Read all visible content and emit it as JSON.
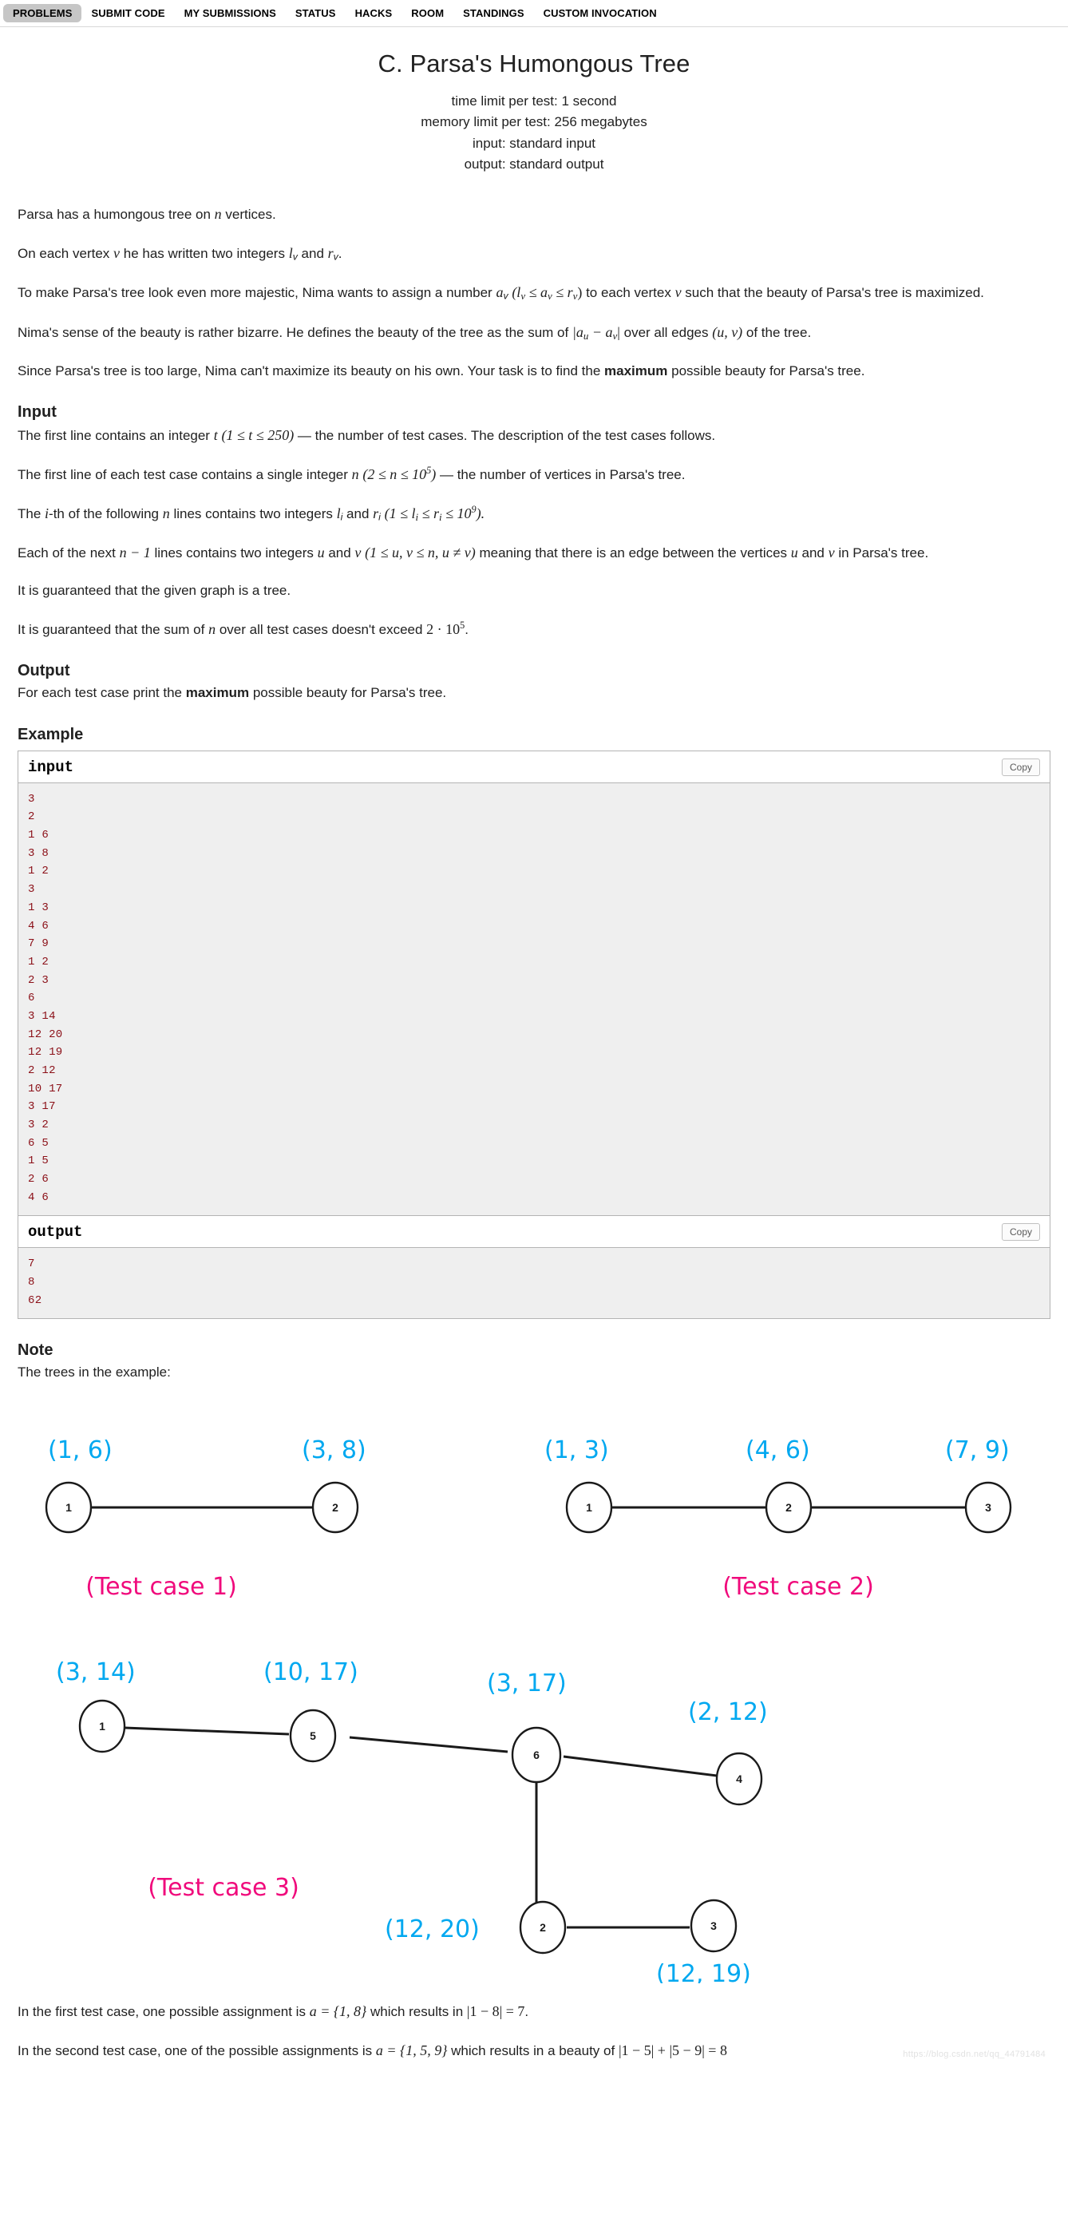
{
  "nav": {
    "items": [
      {
        "label": "PROBLEMS",
        "active": true
      },
      {
        "label": "SUBMIT CODE",
        "active": false
      },
      {
        "label": "MY SUBMISSIONS",
        "active": false
      },
      {
        "label": "STATUS",
        "active": false
      },
      {
        "label": "HACKS",
        "active": false
      },
      {
        "label": "ROOM",
        "active": false
      },
      {
        "label": "STANDINGS",
        "active": false
      },
      {
        "label": "CUSTOM INVOCATION",
        "active": false
      }
    ]
  },
  "problem": {
    "title": "C. Parsa's Humongous Tree",
    "time_limit": "time limit per test: 1 second",
    "memory_limit": "memory limit per test: 256 megabytes",
    "input_spec": "input: standard input",
    "output_spec": "output: standard output"
  },
  "statement": {
    "p1_a": "Parsa has a humongous tree on ",
    "p1_n": "n",
    "p1_b": " vertices.",
    "p2_a": "On each vertex ",
    "p2_v": "v",
    "p2_b": " he has written two integers ",
    "p2_l": "l",
    "p2_lsub": "v",
    "p2_c": " and ",
    "p2_r": "r",
    "p2_rsub": "v",
    "p2_d": ".",
    "p3_a": "To make Parsa's tree look even more majestic, Nima wants to assign a number ",
    "p3_a_sym": "a",
    "p3_a_sub": "v",
    "p3_paren": "(l",
    "p3_paren_sub1": "v",
    "p3_paren2": " ≤ a",
    "p3_paren_sub2": "v",
    "p3_paren3": " ≤ r",
    "p3_paren_sub3": "v",
    "p3_paren4": ")",
    "p3_b": " to each vertex ",
    "p3_v": "v",
    "p3_c": " such that the beauty of Parsa's tree is maximized.",
    "p4_a": "Nima's sense of the beauty is rather bizarre. He defines the beauty of the tree as the sum of ",
    "p4_abs": "|a",
    "p4_sub_u": "u",
    "p4_minus": " − a",
    "p4_sub_v": "v",
    "p4_absend": "|",
    "p4_b": " over all edges ",
    "p4_edge": "(u, v)",
    "p4_c": " of the tree.",
    "p5_a": "Since Parsa's tree is too large, Nima can't maximize its beauty on his own. Your task is to find the ",
    "p5_bold": "maximum",
    "p5_b": " possible beauty for Parsa's tree."
  },
  "input_section": {
    "heading": "Input",
    "l1_a": "The first line contains an integer ",
    "l1_t": "t",
    "l1_range": "(1 ≤ t ≤ 250)",
    "l1_b": " — the number of test cases. The description of the test cases follows.",
    "l2_a": "The first line of each test case contains a single integer ",
    "l2_n": "n",
    "l2_range_a": "(2 ≤ n ≤ 10",
    "l2_range_sup": "5",
    "l2_range_b": ")",
    "l2_b": " — the number of vertices in Parsa's tree.",
    "l3_a": "The ",
    "l3_i": "i",
    "l3_b": "-th of the following ",
    "l3_n": "n",
    "l3_c": " lines contains two integers ",
    "l3_li": "l",
    "l3_li_sub": "i",
    "l3_d": " and ",
    "l3_ri": "r",
    "l3_ri_sub": "i",
    "l3_range_a": "(1 ≤ l",
    "l3_range_sub1": "i",
    "l3_range_mid": " ≤ r",
    "l3_range_sub2": "i",
    "l3_range_b": " ≤ 10",
    "l3_range_sup": "9",
    "l3_range_c": ").",
    "l4_a": "Each of the next ",
    "l4_nm1": "n − 1",
    "l4_b": " lines contains two integers ",
    "l4_u": "u",
    "l4_c": " and ",
    "l4_v": "v",
    "l4_range": "(1 ≤ u, v ≤ n, u ≠ v)",
    "l4_d": " meaning that there is an edge between the vertices ",
    "l4_u2": "u",
    "l4_e": " and ",
    "l4_v2": "v",
    "l4_f": " in Parsa's tree.",
    "l5": "It is guaranteed that the given graph is a tree.",
    "l6_a": "It is guaranteed that the sum of ",
    "l6_n": "n",
    "l6_b": " over all test cases doesn't exceed ",
    "l6_val": "2 · 10",
    "l6_sup": "5",
    "l6_c": "."
  },
  "output_section": {
    "heading": "Output",
    "text_a": "For each test case print the ",
    "text_bold": "maximum",
    "text_b": " possible beauty for Parsa's tree."
  },
  "example": {
    "heading": "Example",
    "input_label": "input",
    "output_label": "output",
    "copy_label": "Copy",
    "input_text": "3\n2\n1 6\n3 8\n1 2\n3\n1 3\n4 6\n7 9\n1 2\n2 3\n6\n3 14\n12 20\n12 19\n2 12\n10 17\n3 17\n3 2\n6 5\n1 5\n2 6\n4 6",
    "output_text": "7\n8\n62"
  },
  "note": {
    "heading": "Note",
    "intro": "The trees in the example:",
    "figures": [
      {
        "caption": "(Test case 1)",
        "nodes": [
          {
            "id": "1",
            "label": "(1, 6)"
          },
          {
            "id": "2",
            "label": "(3, 8)"
          }
        ],
        "edges": [
          [
            "1",
            "2"
          ]
        ]
      },
      {
        "caption": "(Test case 2)",
        "nodes": [
          {
            "id": "1",
            "label": "(1, 3)"
          },
          {
            "id": "2",
            "label": "(4, 6)"
          },
          {
            "id": "3",
            "label": "(7, 9)"
          }
        ],
        "edges": [
          [
            "1",
            "2"
          ],
          [
            "2",
            "3"
          ]
        ]
      },
      {
        "caption": "(Test case 3)",
        "nodes": [
          {
            "id": "1",
            "label": "(3, 14)"
          },
          {
            "id": "5",
            "label": "(10, 17)"
          },
          {
            "id": "6",
            "label": "(3, 17)"
          },
          {
            "id": "4",
            "label": "(2, 12)"
          },
          {
            "id": "2",
            "label": "(12, 20)"
          },
          {
            "id": "3",
            "label": "(12, 19)"
          }
        ],
        "edges": [
          [
            "1",
            "5"
          ],
          [
            "5",
            "6"
          ],
          [
            "6",
            "4"
          ],
          [
            "6",
            "2"
          ],
          [
            "2",
            "3"
          ]
        ]
      }
    ],
    "fig1_labels": {
      "n1": "(1, 6)",
      "n2": "(3, 8)",
      "c1": "1",
      "c2": "2",
      "caption": "(Test case 1)"
    },
    "fig2_labels": {
      "n1": "(1, 3)",
      "n2": "(4, 6)",
      "n3": "(7, 9)",
      "c1": "1",
      "c2": "2",
      "c3": "3",
      "caption": "(Test case 2)"
    },
    "fig3_labels": {
      "n1": "(3, 14)",
      "n5": "(10, 17)",
      "n6": "(3, 17)",
      "n4": "(2, 12)",
      "n2": "(12, 20)",
      "n3": "(12, 19)",
      "c1": "1",
      "c5": "5",
      "c6": "6",
      "c4": "4",
      "c2": "2",
      "c3": "3",
      "caption": "(Test case 3)"
    },
    "expl1_a": "In the first test case, one possible assignment is ",
    "expl1_math": "a = {1, 8}",
    "expl1_b": " which results in ",
    "expl1_math2": "|1 − 8| = 7",
    "expl1_c": ".",
    "expl2_a": "In the second test case, one of the possible assignments is ",
    "expl2_math": "a = {1, 5, 9}",
    "expl2_b": " which results in a beauty of ",
    "expl2_math2": "|1 − 5| + |5 − 9| = 8"
  },
  "watermark": "https://blog.csdn.net/qq_44791484",
  "colors": {
    "node_label": "#00a8f0",
    "caption": "#f00a7c",
    "sample_text": "#8b0f17",
    "nav_active_bg": "#c6c6c6"
  }
}
